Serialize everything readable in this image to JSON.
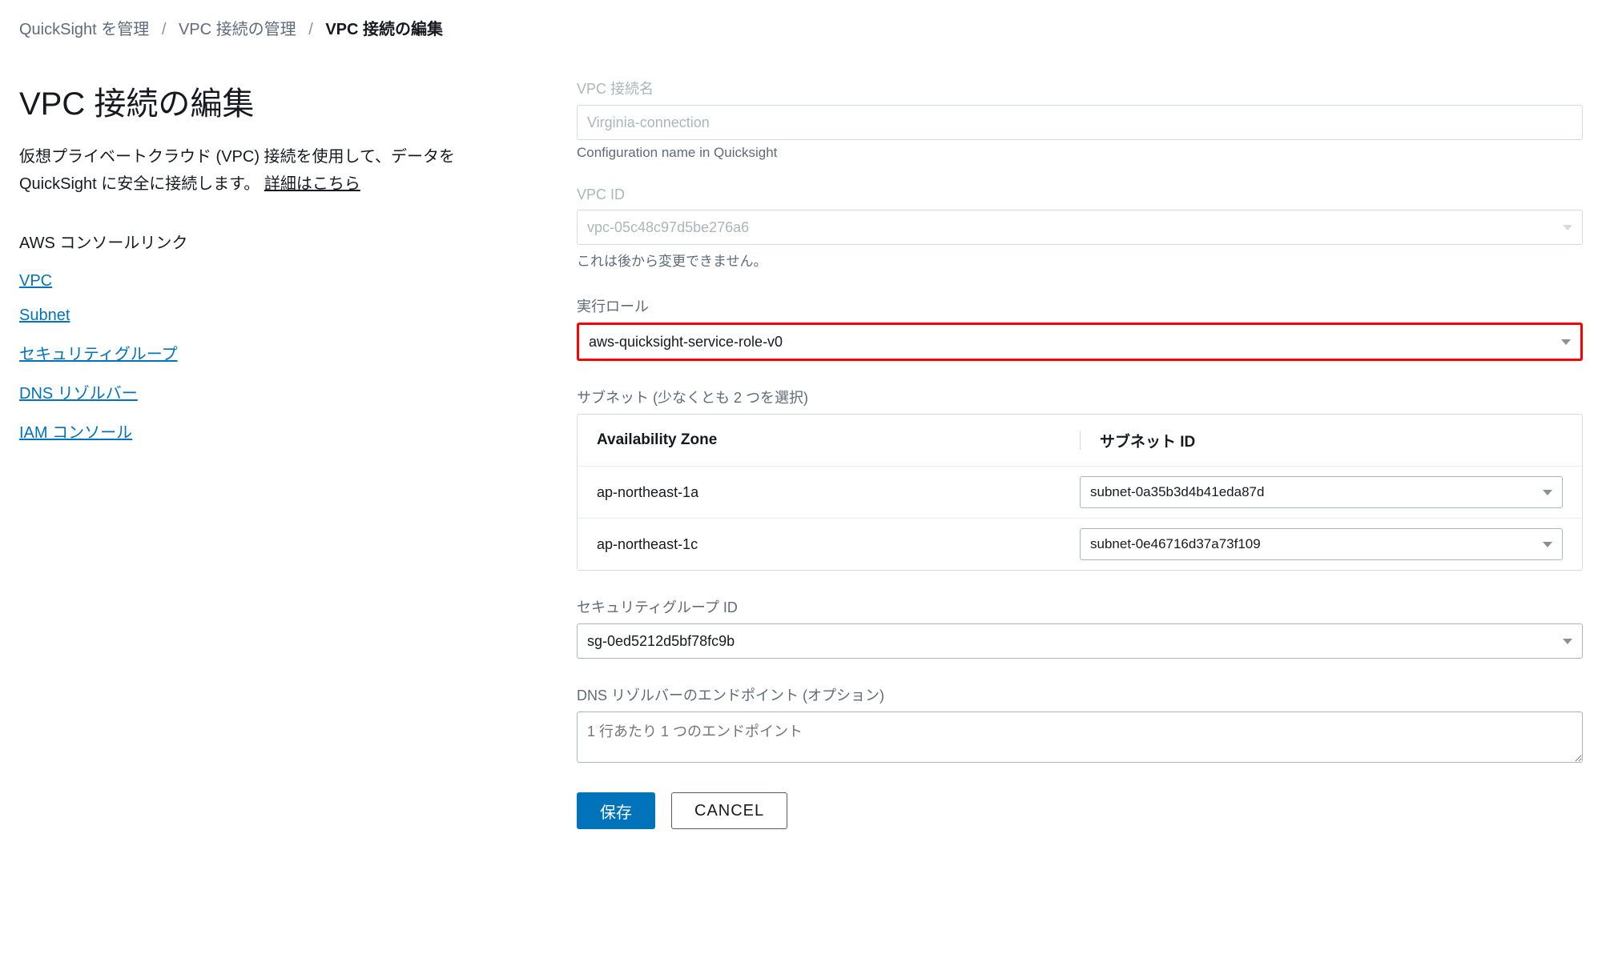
{
  "breadcrumb": {
    "items": [
      "QuickSight を管理",
      "VPC 接続の管理"
    ],
    "current": "VPC 接続の編集"
  },
  "left": {
    "title": "VPC 接続の編集",
    "description_part1": "仮想プライベートクラウド (VPC) 接続を使用して、データを QuickSight に安全に接続します。 ",
    "learn_more": "詳細はこちら",
    "console_links_heading": "AWS コンソールリンク",
    "links": [
      {
        "label": "VPC"
      },
      {
        "label": "Subnet"
      },
      {
        "label": "セキュリティグループ"
      },
      {
        "label": "DNS リゾルバー"
      },
      {
        "label": "IAM コンソール"
      }
    ]
  },
  "form": {
    "conn_name_label": "VPC 接続名",
    "conn_name_value": "Virginia-connection",
    "conn_name_help": "Configuration name in Quicksight",
    "vpc_id_label": "VPC ID",
    "vpc_id_value": "vpc-05c48c97d5be276a6",
    "vpc_id_help": "これは後から変更できません。",
    "exec_role_label": "実行ロール",
    "exec_role_value": "aws-quicksight-service-role-v0",
    "subnet_label": "サブネット (少なくとも 2 つを選択)",
    "subnet_header_az": "Availability Zone",
    "subnet_header_id": "サブネット ID",
    "subnets": [
      {
        "az": "ap-northeast-1a",
        "id": "subnet-0a35b3d4b41eda87d"
      },
      {
        "az": "ap-northeast-1c",
        "id": "subnet-0e46716d37a73f109"
      }
    ],
    "sg_label": "セキュリティグループ ID",
    "sg_value": "sg-0ed5212d5bf78fc9b",
    "dns_label": "DNS リゾルバーのエンドポイント (オプション)",
    "dns_placeholder": "1 行あたり 1 つのエンドポイント",
    "save_label": "保存",
    "cancel_label": "CANCEL"
  }
}
